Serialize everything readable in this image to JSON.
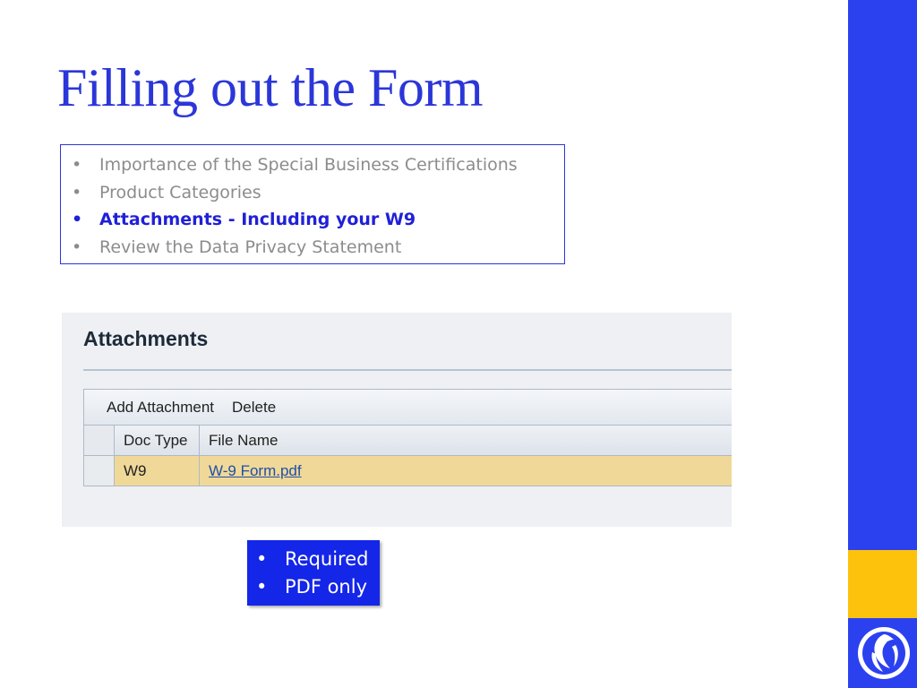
{
  "slide": {
    "title": "Filling out the Form"
  },
  "topics": [
    {
      "label": "Importance of the Special Business Certifications",
      "active": false
    },
    {
      "label": "Product Categories",
      "active": false
    },
    {
      "label": "Attachments - Including your W9",
      "active": true
    },
    {
      "label": "Review the Data Privacy Statement",
      "active": false
    }
  ],
  "attachments_panel": {
    "heading": "Attachments",
    "toolbar": {
      "add_label": "Add Attachment",
      "delete_label": "Delete"
    },
    "columns": [
      "Doc Type",
      "File Name"
    ],
    "rows": [
      {
        "doc_type": "W9",
        "file_name": "W-9 Form.pdf"
      }
    ]
  },
  "notes": [
    "Required",
    "PDF only"
  ],
  "bullet_glyph": "•",
  "colors": {
    "title": "#2b36d9",
    "side_blue": "#2b41f0",
    "side_yellow": "#fdc20c",
    "notes_bg": "#1426e8",
    "selected_row": "#f0d898"
  },
  "logo": {
    "icon": "phoenix-bird-icon"
  }
}
